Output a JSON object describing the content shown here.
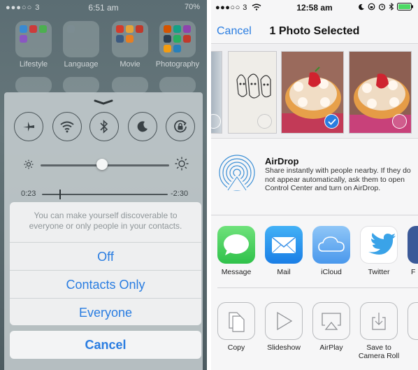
{
  "left": {
    "status_bar": {
      "carrier": "●●●○○ 3",
      "time": "6:51 am",
      "battery": "70%"
    },
    "folders": [
      {
        "label": "Lifestyle"
      },
      {
        "label": "Language"
      },
      {
        "label": "Movie"
      },
      {
        "label": "Photography"
      }
    ],
    "control_center": {
      "toggles": [
        "airplane-icon",
        "wifi-icon",
        "bluetooth-icon",
        "moon-icon",
        "rotation-lock-icon"
      ],
      "brightness_level": 0.48,
      "music": {
        "elapsed": "0:23",
        "remaining": "-2:30",
        "progress": 0.14
      }
    },
    "airdrop_sheet": {
      "message": "You can make yourself discoverable to everyone or only people in your contacts.",
      "options": [
        "Off",
        "Contacts Only",
        "Everyone"
      ],
      "cancel": "Cancel"
    }
  },
  "right": {
    "status_bar": {
      "carrier": "●●●○○ 3",
      "time": "12:58 am"
    },
    "nav": {
      "cancel": "Cancel",
      "title": "1 Photo Selected"
    },
    "airdrop": {
      "title": "AirDrop",
      "description": "Share instantly with people nearby. If they do not appear automatically, ask them to open Control Center and turn on AirDrop."
    },
    "share_apps": [
      {
        "label": "Message",
        "icon": "message-icon",
        "color": "#4cd964"
      },
      {
        "label": "Mail",
        "icon": "mail-icon",
        "color": "#1e8ff0"
      },
      {
        "label": "iCloud",
        "icon": "icloud-icon",
        "color": "#5fa7f2"
      },
      {
        "label": "Twitter",
        "icon": "twitter-icon",
        "color": "#ffffff"
      }
    ],
    "actions": [
      {
        "label": "Copy",
        "icon": "copy-icon"
      },
      {
        "label": "Slideshow",
        "icon": "play-icon"
      },
      {
        "label": "AirPlay",
        "icon": "airplay-icon"
      },
      {
        "label": "Save to Camera Roll",
        "icon": "save-to-camera-roll-icon"
      }
    ],
    "accent": "#2a7de1"
  }
}
